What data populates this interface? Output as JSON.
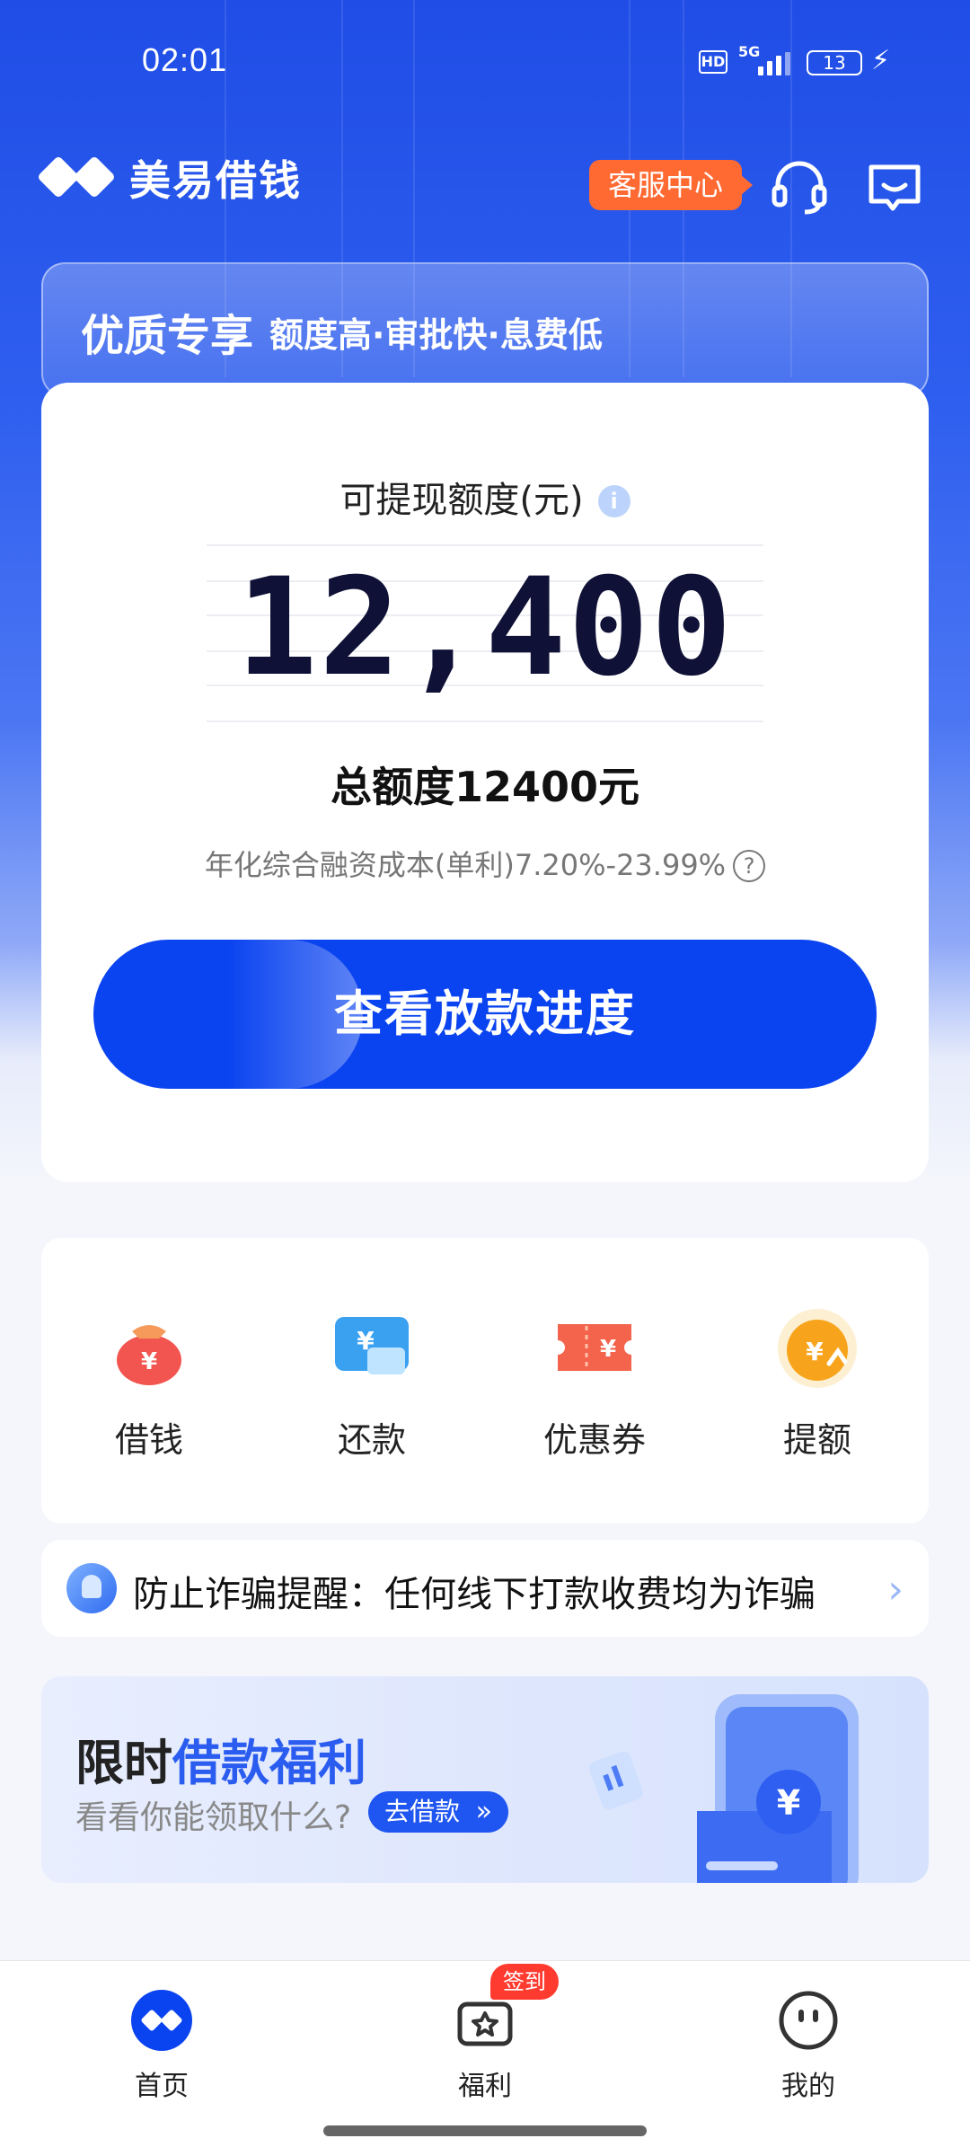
{
  "status_bar": {
    "time": "02:01",
    "hd": "HD",
    "network": "5G",
    "battery": "13"
  },
  "header": {
    "app_name": "美易借钱",
    "service_label": "客服中心"
  },
  "promo": {
    "title": "优质专享",
    "subtitle": "额度高·审批快·息费低"
  },
  "credit_card": {
    "label": "可提现额度(元)",
    "info_glyph": "i",
    "amount": "12,400",
    "total_label": "总额度12400元",
    "rate_text": "年化综合融资成本(单利)7.20%-23.99%",
    "help_glyph": "?",
    "cta_label": "查看放款进度"
  },
  "quick_actions": [
    {
      "label": "借钱",
      "icon": "money-bag-icon"
    },
    {
      "label": "还款",
      "icon": "repay-card-icon"
    },
    {
      "label": "优惠券",
      "icon": "coupon-icon"
    },
    {
      "label": "提额",
      "icon": "raise-limit-icon"
    }
  ],
  "notice": {
    "text": "防止诈骗提醒：任何线下打款收费均为诈骗",
    "arrow": "›"
  },
  "banner": {
    "title_plain": "限时",
    "title_highlight": "借款福利",
    "subtitle": "看看你能领取什么?",
    "button_label": "去借款",
    "coin_glyph": "¥"
  },
  "bottom_nav": {
    "tabs": [
      {
        "label": "首页",
        "active": true
      },
      {
        "label": "福利",
        "active": false
      },
      {
        "label": "我的",
        "active": false
      }
    ],
    "badge": "签到"
  },
  "colors": {
    "primary": "#0a43f0",
    "accent_orange": "#ff6a33",
    "badge_red": "#ff3b30"
  }
}
